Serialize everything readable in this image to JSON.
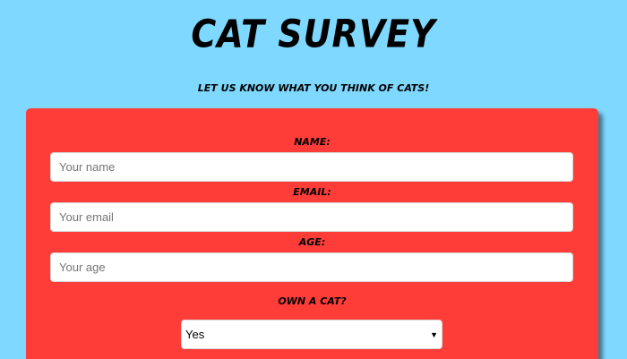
{
  "header": {
    "title": "CAT SURVEY",
    "subtitle": "LET US KNOW WHAT YOU THINK OF CATS!"
  },
  "form": {
    "name": {
      "label": "NAME:",
      "placeholder": "Your name"
    },
    "email": {
      "label": "EMAIL:",
      "placeholder": "Your email"
    },
    "age": {
      "label": "AGE:",
      "placeholder": "Your age"
    },
    "own_cat": {
      "label": "OWN A CAT?",
      "selected": "Yes",
      "arrow_icon": "dropdown-arrow-icon"
    }
  },
  "colors": {
    "background": "#7fd8ff",
    "card": "#ff3d38"
  }
}
